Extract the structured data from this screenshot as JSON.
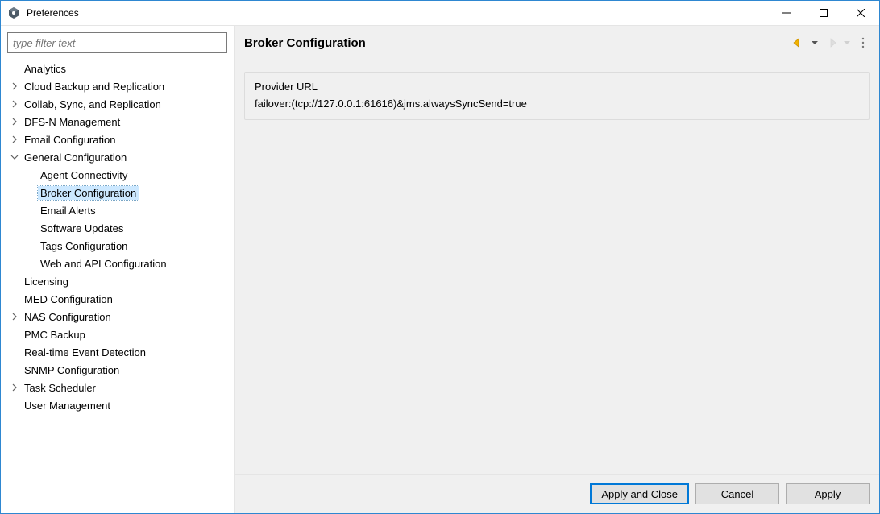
{
  "window": {
    "title": "Preferences"
  },
  "filter": {
    "placeholder": "type filter text"
  },
  "tree": {
    "items": [
      {
        "label": "Analytics",
        "depth": 0,
        "expandable": false,
        "expanded": false,
        "selected": false
      },
      {
        "label": "Cloud Backup and Replication",
        "depth": 0,
        "expandable": true,
        "expanded": false,
        "selected": false
      },
      {
        "label": "Collab, Sync, and Replication",
        "depth": 0,
        "expandable": true,
        "expanded": false,
        "selected": false
      },
      {
        "label": "DFS-N Management",
        "depth": 0,
        "expandable": true,
        "expanded": false,
        "selected": false
      },
      {
        "label": "Email Configuration",
        "depth": 0,
        "expandable": true,
        "expanded": false,
        "selected": false
      },
      {
        "label": "General Configuration",
        "depth": 0,
        "expandable": true,
        "expanded": true,
        "selected": false
      },
      {
        "label": "Agent Connectivity",
        "depth": 1,
        "expandable": false,
        "expanded": false,
        "selected": false
      },
      {
        "label": "Broker Configuration",
        "depth": 1,
        "expandable": false,
        "expanded": false,
        "selected": true
      },
      {
        "label": "Email Alerts",
        "depth": 1,
        "expandable": false,
        "expanded": false,
        "selected": false
      },
      {
        "label": "Software Updates",
        "depth": 1,
        "expandable": false,
        "expanded": false,
        "selected": false
      },
      {
        "label": "Tags Configuration",
        "depth": 1,
        "expandable": false,
        "expanded": false,
        "selected": false
      },
      {
        "label": "Web and API Configuration",
        "depth": 1,
        "expandable": false,
        "expanded": false,
        "selected": false
      },
      {
        "label": "Licensing",
        "depth": 0,
        "expandable": false,
        "expanded": false,
        "selected": false
      },
      {
        "label": "MED Configuration",
        "depth": 0,
        "expandable": false,
        "expanded": false,
        "selected": false
      },
      {
        "label": "NAS Configuration",
        "depth": 0,
        "expandable": true,
        "expanded": false,
        "selected": false
      },
      {
        "label": "PMC Backup",
        "depth": 0,
        "expandable": false,
        "expanded": false,
        "selected": false
      },
      {
        "label": "Real-time Event Detection",
        "depth": 0,
        "expandable": false,
        "expanded": false,
        "selected": false
      },
      {
        "label": "SNMP Configuration",
        "depth": 0,
        "expandable": false,
        "expanded": false,
        "selected": false
      },
      {
        "label": "Task Scheduler",
        "depth": 0,
        "expandable": true,
        "expanded": false,
        "selected": false
      },
      {
        "label": "User Management",
        "depth": 0,
        "expandable": false,
        "expanded": false,
        "selected": false
      }
    ]
  },
  "content": {
    "heading": "Broker Configuration",
    "group": {
      "legend": "Provider URL",
      "value": "failover:(tcp://127.0.0.1:61616)&jms.alwaysSyncSend=true"
    }
  },
  "buttons": {
    "apply_and_close": "Apply and Close",
    "cancel": "Cancel",
    "apply": "Apply"
  }
}
